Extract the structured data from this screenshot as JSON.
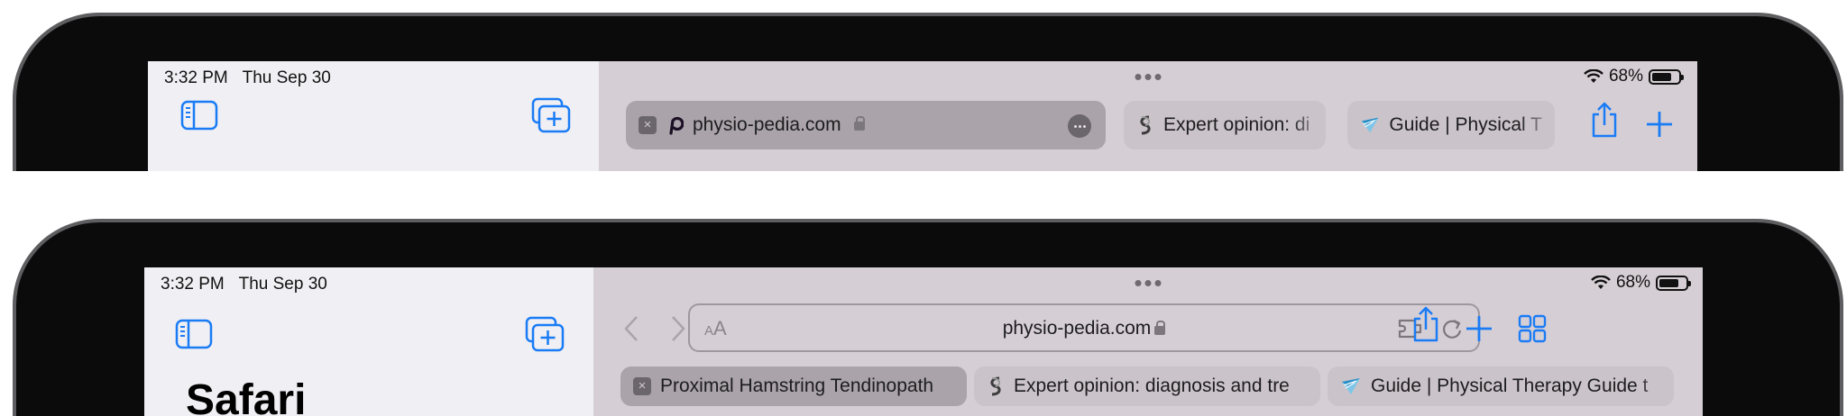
{
  "top": {
    "status": {
      "time": "3:32 PM",
      "date": "Thu Sep 30",
      "battery": "68%"
    },
    "tabs": [
      {
        "title": "physio-pedia.com",
        "favicon": "physiopedia-icon",
        "active": true
      },
      {
        "title": "Expert opinion: di",
        "favicon": "expert-opinion-icon",
        "active": false
      },
      {
        "title": "Guide | Physical T",
        "favicon": "guide-pt-icon",
        "active": false
      }
    ],
    "icons": {
      "sidebar": "sidebar-icon",
      "new_tab_group": "tab-group-add-icon",
      "share": "share-icon",
      "new_tab": "plus-icon"
    }
  },
  "bottom": {
    "status": {
      "time": "3:32 PM",
      "date": "Thu Sep 30",
      "battery": "68%"
    },
    "sidebar_title": "Safari",
    "address": {
      "reader_label": "AA",
      "url": "physio-pedia.com"
    },
    "tabs": [
      {
        "title": "Proximal Hamstring Tendinopath",
        "favicon": "close-icon",
        "active": true
      },
      {
        "title": "Expert opinion: diagnosis and tre",
        "favicon": "expert-opinion-icon",
        "active": false
      },
      {
        "title": "Guide | Physical Therapy Guide t",
        "favicon": "guide-pt-icon",
        "active": false
      }
    ],
    "icons": {
      "back": "chevron-left-icon",
      "forward": "chevron-right-icon",
      "extensions": "puzzle-icon",
      "reload": "reload-icon",
      "share": "share-icon",
      "new_tab": "plus-icon",
      "tab_overview": "grid-icon"
    }
  },
  "colors": {
    "accent": "#1a7cf5",
    "sidebar_bg": "#f0eff4",
    "content_bg": "#d6ced5",
    "tab_bg": "#cbc3ca",
    "active_tab_bg": "#aaa3aa"
  }
}
